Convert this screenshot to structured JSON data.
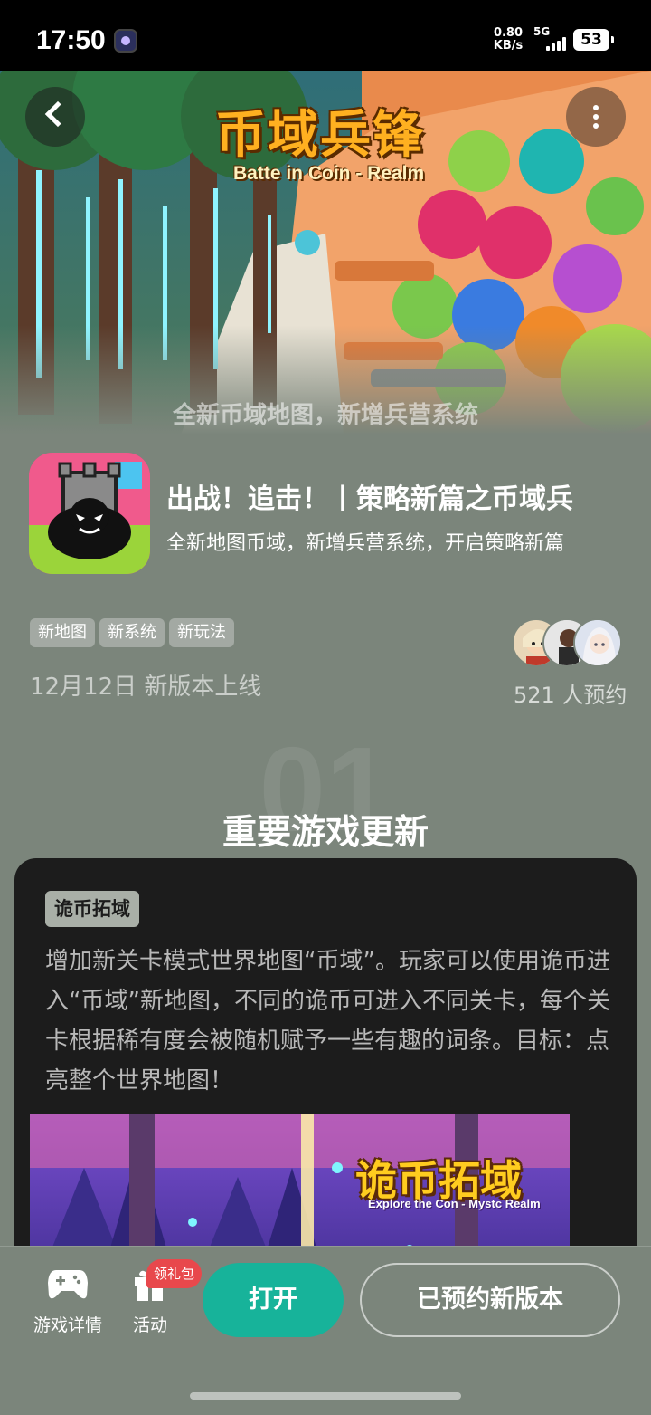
{
  "status_bar": {
    "time": "17:50",
    "net_speed": "0.80",
    "net_unit": "KB/s",
    "network_type": "5G",
    "battery": "53"
  },
  "banner": {
    "title": "币域兵锋",
    "subtitle": "Batte in Coin - Realm",
    "caption": "全新币域地图，新增兵营系统"
  },
  "game": {
    "title": "出战！追击！丨策略新篇之币域兵",
    "description": "全新地图币域，新增兵营系统，开启策略新篇",
    "tags": [
      "新地图",
      "新系统",
      "新玩法"
    ],
    "release_date": "12月12日 新版本上线",
    "reserve_count": "521 人预约"
  },
  "section": {
    "number": "01",
    "title": "重要游戏更新"
  },
  "update": {
    "tag": "诡币拓域",
    "text": "增加新关卡模式世界地图“币域”。玩家可以使用诡币进入“币域”新地图，不同的诡币可进入不同关卡，每个关卡根据稀有度会被随机赋予一些有趣的词条。目标：点亮整个世界地图！",
    "image_title": "诡币拓域",
    "image_subtitle": "Explore the Con - Mystc Realm"
  },
  "bottom_bar": {
    "details_label": "游戏详情",
    "activity_label": "活动",
    "gift_badge": "领礼包",
    "open_label": "打开",
    "reserved_label": "已预约新版本"
  },
  "colors": {
    "background": "#7b857b",
    "open_button": "#17b39a",
    "gift_badge": "#e8484c",
    "card": "#1c1c1c"
  }
}
